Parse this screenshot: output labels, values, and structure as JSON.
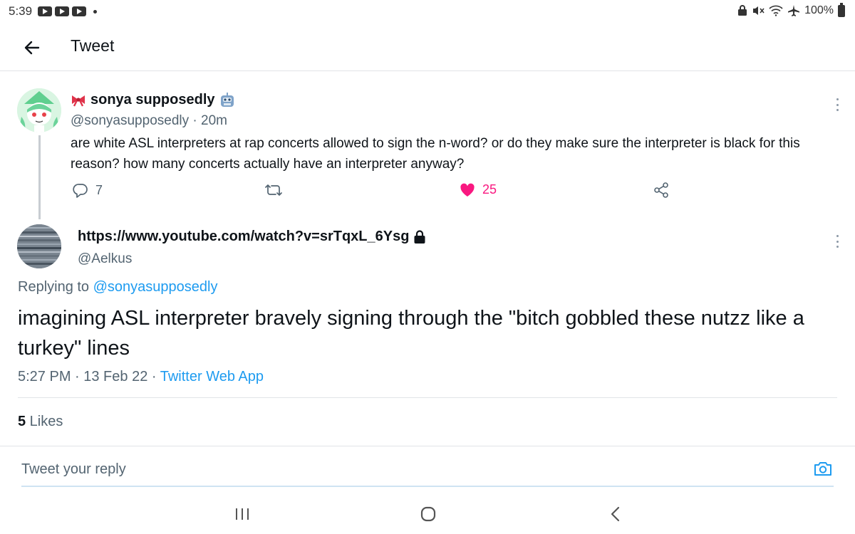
{
  "status_bar": {
    "time": "5:39",
    "battery": "100%"
  },
  "header": {
    "title": "Tweet"
  },
  "parent_tweet": {
    "display_name": "sonya supposedly",
    "handle_time": "@sonyasupposedly · 20m",
    "text": "are white ASL interpreters at rap concerts allowed to sign the n-word? or do they make sure the interpreter is black for this reason? how many concerts actually have an interpreter anyway?",
    "reply_count": "7",
    "like_count": "25",
    "colors": {
      "like": "#f91880"
    }
  },
  "main_tweet": {
    "display_name": "https://www.youtube.com/watch?v=srTqxL_6Ysg",
    "handle": "@Aelkus",
    "replying_prefix": "Replying to ",
    "replying_handle": "@sonyasupposedly",
    "text": "imagining ASL interpreter bravely signing through the \"bitch gobbled these nutzz like a turkey\" lines",
    "timestamp": "5:27 PM · 13 Feb 22 · ",
    "source": "Twitter Web App",
    "likes_count": "5",
    "likes_label": " Likes",
    "colors": {
      "link": "#1d9bf0"
    }
  },
  "reply_bar": {
    "placeholder": "Tweet your reply"
  },
  "icons": {
    "reply": "reply-icon",
    "retweet": "retweet-icon",
    "like": "heart-icon",
    "share": "share-icon",
    "camera": "camera-icon",
    "lock": "lock-icon"
  }
}
